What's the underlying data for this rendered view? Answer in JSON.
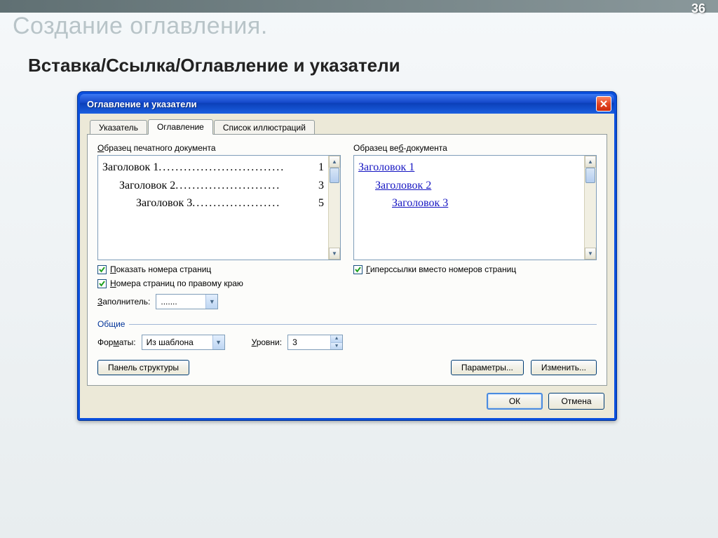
{
  "slide": {
    "number": "36",
    "faded_title": "Создание оглавления.",
    "breadcrumb": "Вставка/Ссылка/Оглавление и указатели"
  },
  "dialog": {
    "title": "Оглавление и указатели",
    "tabs": {
      "index": "Указатель",
      "toc": "Оглавление",
      "figures": "Список иллюстраций"
    },
    "print_preview_label": "Образец печатного документа",
    "web_preview_label": "Образец веб-документа",
    "toc_items": [
      {
        "text": "Заголовок 1",
        "page": "1"
      },
      {
        "text": "Заголовок 2",
        "page": "3"
      },
      {
        "text": "Заголовок 3",
        "page": "5"
      }
    ],
    "web_items": [
      "Заголовок 1",
      "Заголовок 2",
      "Заголовок 3"
    ],
    "show_page_numbers": "Показать номера страниц",
    "right_align_numbers": "Номера страниц по правому краю",
    "hyperlinks_instead": "Гиперссылки вместо номеров страниц",
    "leader_label": "Заполнитель:",
    "leader_value": ".......",
    "general_label": "Общие",
    "formats_label": "Форматы:",
    "formats_value": "Из шаблона",
    "levels_label": "Уровни:",
    "levels_value": "3",
    "outline_button": "Панель структуры",
    "options_button": "Параметры...",
    "modify_button": "Изменить...",
    "ok_button": "ОК",
    "cancel_button": "Отмена"
  }
}
